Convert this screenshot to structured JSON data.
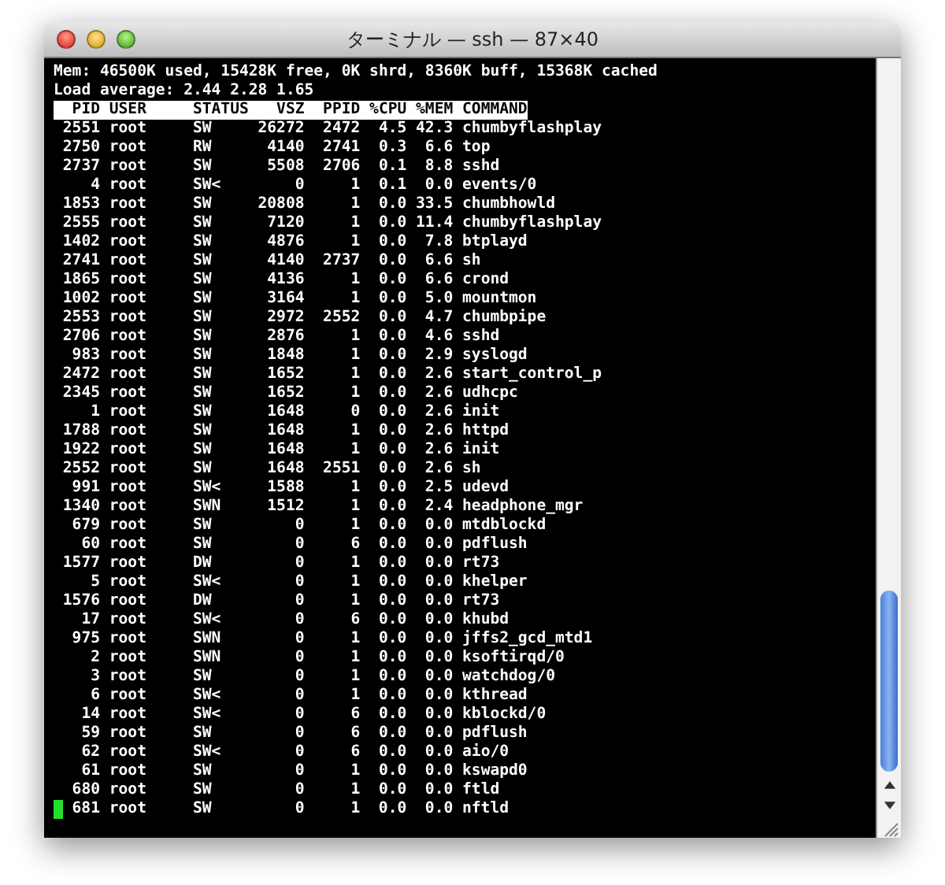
{
  "window": {
    "title": "ターミナル — ssh — 87×40"
  },
  "terminal": {
    "summary_lines": [
      "Mem: 46500K used, 15428K free, 0K shrd, 8360K buff, 15368K cached",
      "Load average: 2.44 2.28 1.65"
    ],
    "columns": [
      "PID",
      "USER",
      "STATUS",
      "VSZ",
      "PPID",
      "%CPU",
      "%MEM",
      "COMMAND"
    ],
    "rows": [
      [
        "2551",
        "root",
        "SW",
        "26272",
        "2472",
        "4.5",
        "42.3",
        "chumbyflashplay"
      ],
      [
        "2750",
        "root",
        "RW",
        "4140",
        "2741",
        "0.3",
        "6.6",
        "top"
      ],
      [
        "2737",
        "root",
        "SW",
        "5508",
        "2706",
        "0.1",
        "8.8",
        "sshd"
      ],
      [
        "4",
        "root",
        "SW<",
        "0",
        "1",
        "0.1",
        "0.0",
        "events/0"
      ],
      [
        "1853",
        "root",
        "SW",
        "20808",
        "1",
        "0.0",
        "33.5",
        "chumbhowld"
      ],
      [
        "2555",
        "root",
        "SW",
        "7120",
        "1",
        "0.0",
        "11.4",
        "chumbyflashplay"
      ],
      [
        "1402",
        "root",
        "SW",
        "4876",
        "1",
        "0.0",
        "7.8",
        "btplayd"
      ],
      [
        "2741",
        "root",
        "SW",
        "4140",
        "2737",
        "0.0",
        "6.6",
        "sh"
      ],
      [
        "1865",
        "root",
        "SW",
        "4136",
        "1",
        "0.0",
        "6.6",
        "crond"
      ],
      [
        "1002",
        "root",
        "SW",
        "3164",
        "1",
        "0.0",
        "5.0",
        "mountmon"
      ],
      [
        "2553",
        "root",
        "SW",
        "2972",
        "2552",
        "0.0",
        "4.7",
        "chumbpipe"
      ],
      [
        "2706",
        "root",
        "SW",
        "2876",
        "1",
        "0.0",
        "4.6",
        "sshd"
      ],
      [
        "983",
        "root",
        "SW",
        "1848",
        "1",
        "0.0",
        "2.9",
        "syslogd"
      ],
      [
        "2472",
        "root",
        "SW",
        "1652",
        "1",
        "0.0",
        "2.6",
        "start_control_p"
      ],
      [
        "2345",
        "root",
        "SW",
        "1652",
        "1",
        "0.0",
        "2.6",
        "udhcpc"
      ],
      [
        "1",
        "root",
        "SW",
        "1648",
        "0",
        "0.0",
        "2.6",
        "init"
      ],
      [
        "1788",
        "root",
        "SW",
        "1648",
        "1",
        "0.0",
        "2.6",
        "httpd"
      ],
      [
        "1922",
        "root",
        "SW",
        "1648",
        "1",
        "0.0",
        "2.6",
        "init"
      ],
      [
        "2552",
        "root",
        "SW",
        "1648",
        "2551",
        "0.0",
        "2.6",
        "sh"
      ],
      [
        "991",
        "root",
        "SW<",
        "1588",
        "1",
        "0.0",
        "2.5",
        "udevd"
      ],
      [
        "1340",
        "root",
        "SWN",
        "1512",
        "1",
        "0.0",
        "2.4",
        "headphone_mgr"
      ],
      [
        "679",
        "root",
        "SW",
        "0",
        "1",
        "0.0",
        "0.0",
        "mtdblockd"
      ],
      [
        "60",
        "root",
        "SW",
        "0",
        "6",
        "0.0",
        "0.0",
        "pdflush"
      ],
      [
        "1577",
        "root",
        "DW",
        "0",
        "1",
        "0.0",
        "0.0",
        "rt73"
      ],
      [
        "5",
        "root",
        "SW<",
        "0",
        "1",
        "0.0",
        "0.0",
        "khelper"
      ],
      [
        "1576",
        "root",
        "DW",
        "0",
        "1",
        "0.0",
        "0.0",
        "rt73"
      ],
      [
        "17",
        "root",
        "SW<",
        "0",
        "6",
        "0.0",
        "0.0",
        "khubd"
      ],
      [
        "975",
        "root",
        "SWN",
        "0",
        "1",
        "0.0",
        "0.0",
        "jffs2_gcd_mtd1"
      ],
      [
        "2",
        "root",
        "SWN",
        "0",
        "1",
        "0.0",
        "0.0",
        "ksoftirqd/0"
      ],
      [
        "3",
        "root",
        "SW",
        "0",
        "1",
        "0.0",
        "0.0",
        "watchdog/0"
      ],
      [
        "6",
        "root",
        "SW<",
        "0",
        "1",
        "0.0",
        "0.0",
        "kthread"
      ],
      [
        "14",
        "root",
        "SW<",
        "0",
        "6",
        "0.0",
        "0.0",
        "kblockd/0"
      ],
      [
        "59",
        "root",
        "SW",
        "0",
        "6",
        "0.0",
        "0.0",
        "pdflush"
      ],
      [
        "62",
        "root",
        "SW<",
        "0",
        "6",
        "0.0",
        "0.0",
        "aio/0"
      ],
      [
        "61",
        "root",
        "SW",
        "0",
        "1",
        "0.0",
        "0.0",
        "kswapd0"
      ],
      [
        "680",
        "root",
        "SW",
        "0",
        "1",
        "0.0",
        "0.0",
        "ftld"
      ],
      [
        "681",
        "root",
        "SW",
        "0",
        "1",
        "0.0",
        "0.0",
        "nftld"
      ]
    ]
  }
}
